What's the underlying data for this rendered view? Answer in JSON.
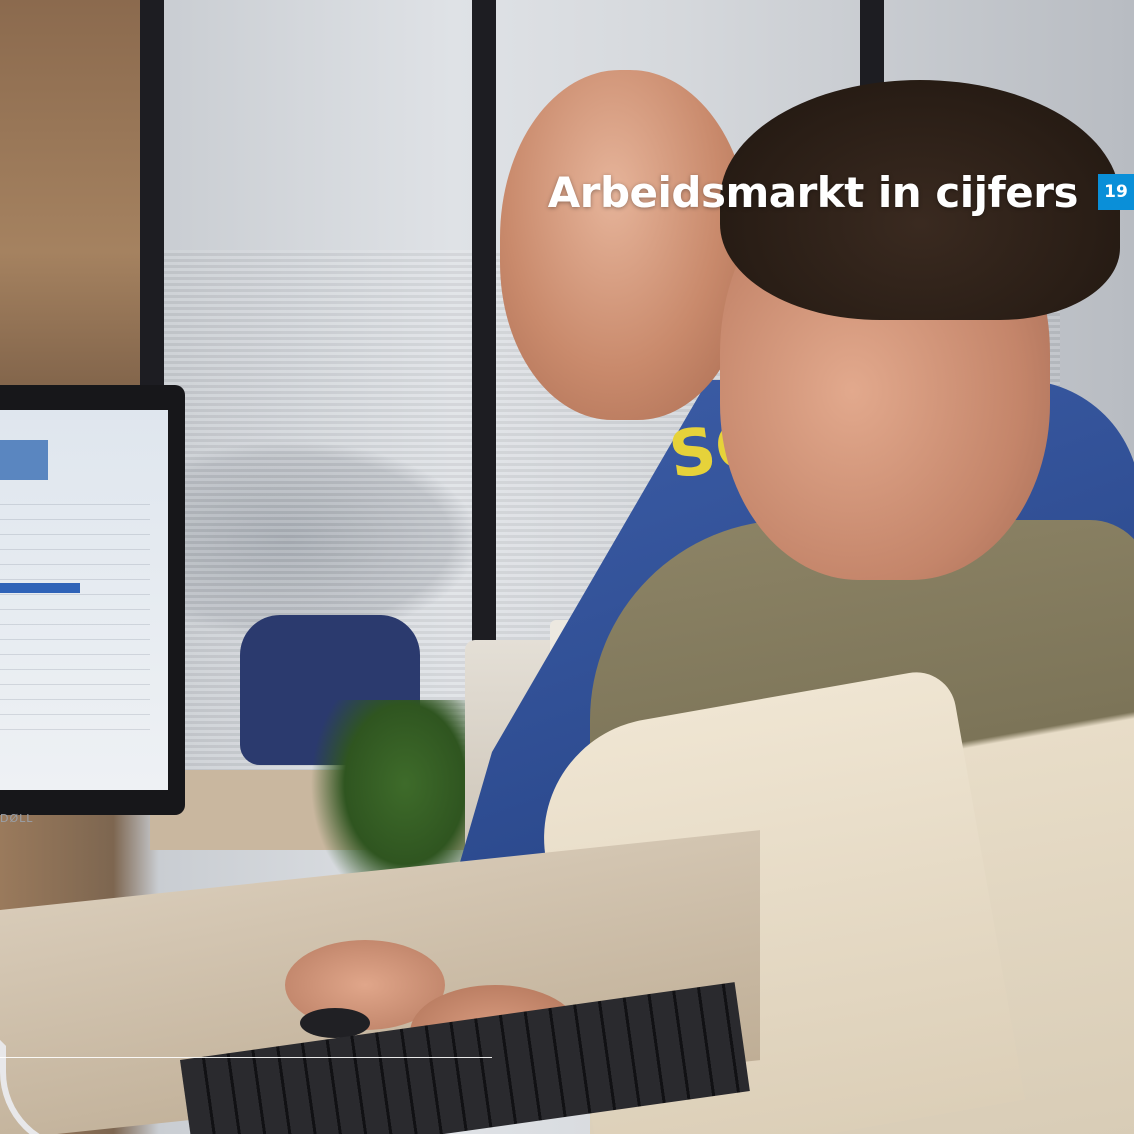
{
  "page": {
    "title": "Arbeidsmarkt in cijfers",
    "page_number": "19",
    "accent_color": "#0a8fd8"
  },
  "photo": {
    "monitor_brand": "DØLL"
  }
}
